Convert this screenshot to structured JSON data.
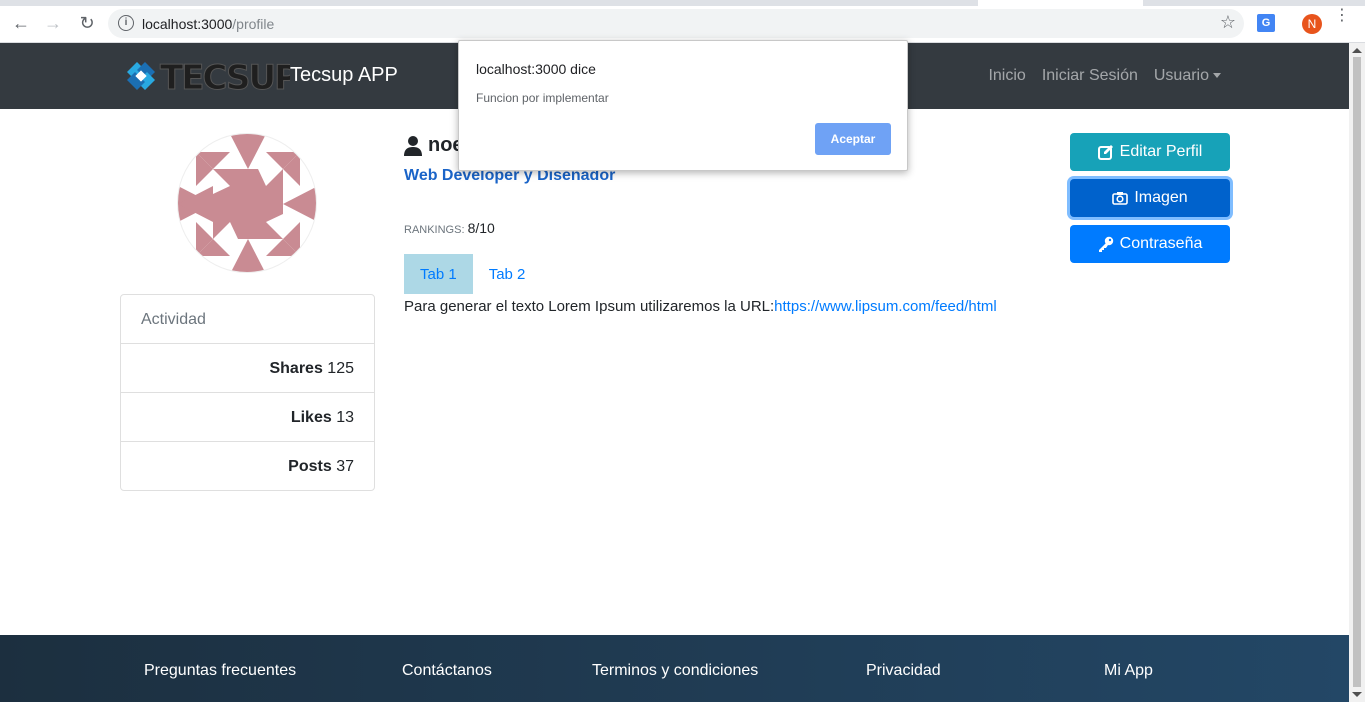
{
  "browser": {
    "url_host": "localhost:3000",
    "url_path": "/profile",
    "avatar_letter": "N",
    "translate_icon": "G"
  },
  "navbar": {
    "brand": "Tecsup APP",
    "links": [
      "Inicio",
      "Iniciar Sesión",
      "Usuario"
    ]
  },
  "profile": {
    "name": "noe",
    "subtitle": "Web Developer y Diseñador",
    "rankings_label": "RANKINGS:",
    "rankings_value": "8/10",
    "tabs": [
      "Tab 1",
      "Tab 2"
    ],
    "tab_text": "Para generar el texto Lorem Ipsum utilizaremos la URL:",
    "tab_link": "https://www.lipsum.com/feed/html"
  },
  "activity": {
    "header": "Actividad",
    "rows": [
      {
        "label": "Shares",
        "value": "125"
      },
      {
        "label": "Likes",
        "value": "13"
      },
      {
        "label": "Posts",
        "value": "37"
      }
    ]
  },
  "actions": {
    "edit": "Editar Perfil",
    "image": "Imagen",
    "password": "Contraseña"
  },
  "footer": {
    "links": [
      "Preguntas frecuentes",
      "Contáctanos",
      "Terminos y condiciones",
      "Privacidad",
      "Mi App"
    ]
  },
  "dialog": {
    "title": "localhost:3000 dice",
    "message": "Funcion por implementar",
    "ok": "Aceptar"
  },
  "colors": {
    "navbar": "#343a40",
    "info_button": "#17a2b8",
    "primary": "#007bff",
    "footer": "#1c2f3f",
    "identicon": "#c98b93"
  }
}
